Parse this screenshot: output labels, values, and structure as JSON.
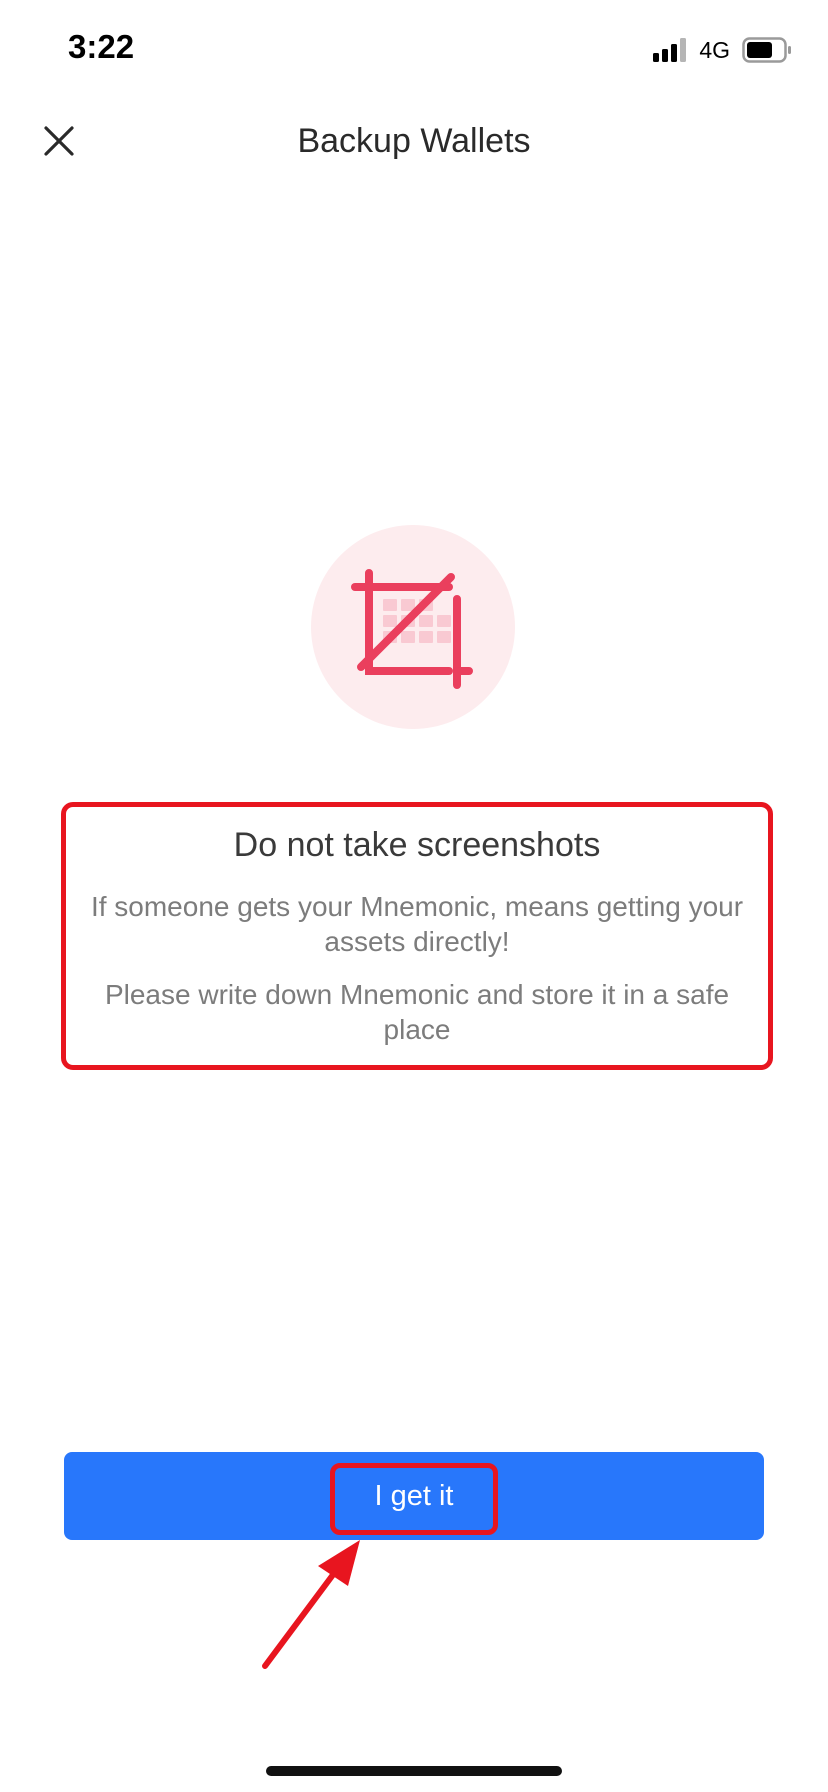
{
  "status_bar": {
    "time": "3:22",
    "network": "4G",
    "signal_icon": "cellular-signal-icon",
    "battery_icon": "battery-icon"
  },
  "header": {
    "title": "Backup Wallets",
    "close_icon": "close-icon"
  },
  "illustration": {
    "icon": "no-screenshot-crop-icon",
    "accent_color": "#ea3f5d",
    "background_color": "#fdecee"
  },
  "warning": {
    "heading": "Do not take screenshots",
    "line1": "If someone gets your Mnemonic, means getting your assets directly!",
    "line2": "Please write down Mnemonic and store it in a safe place"
  },
  "confirm": {
    "label": "I get it",
    "color": "#2877fb"
  },
  "annotations": {
    "highlight_color": "#e8151f",
    "arrow_icon": "red-arrow-icon"
  }
}
